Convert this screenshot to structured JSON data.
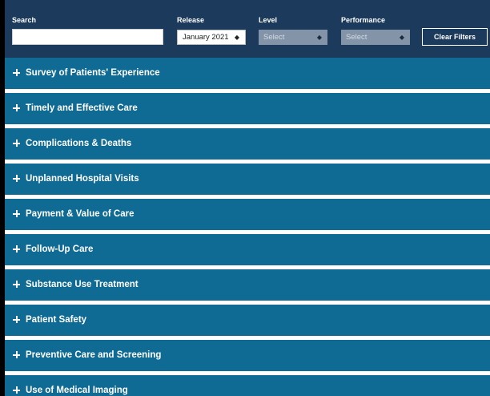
{
  "filters": {
    "search": {
      "label": "Search",
      "value": "",
      "placeholder": ""
    },
    "release": {
      "label": "Release",
      "selected": "January 2021"
    },
    "level": {
      "label": "Level",
      "selected": "Select"
    },
    "performance": {
      "label": "Performance",
      "selected": "Select"
    },
    "clear_label": "Clear Filters"
  },
  "sections": [
    {
      "label": "Survey of Patients' Experience",
      "icon": "plus-icon"
    },
    {
      "label": "Timely and Effective Care",
      "icon": "plus-icon"
    },
    {
      "label": "Complications & Deaths",
      "icon": "plus-icon"
    },
    {
      "label": "Unplanned Hospital Visits",
      "icon": "plus-icon"
    },
    {
      "label": "Payment & Value of Care",
      "icon": "plus-icon"
    },
    {
      "label": "Follow-Up Care",
      "icon": "plus-icon"
    },
    {
      "label": "Substance Use Treatment",
      "icon": "plus-icon"
    },
    {
      "label": "Patient Safety",
      "icon": "plus-icon"
    },
    {
      "label": "Preventive Care and Screening",
      "icon": "plus-icon"
    },
    {
      "label": "Use of Medical Imaging",
      "icon": "plus-icon"
    }
  ],
  "colors": {
    "filter_bar": "#1b3a5c",
    "section_bar": "#0f6b93",
    "disabled_select": "#8494a8"
  }
}
